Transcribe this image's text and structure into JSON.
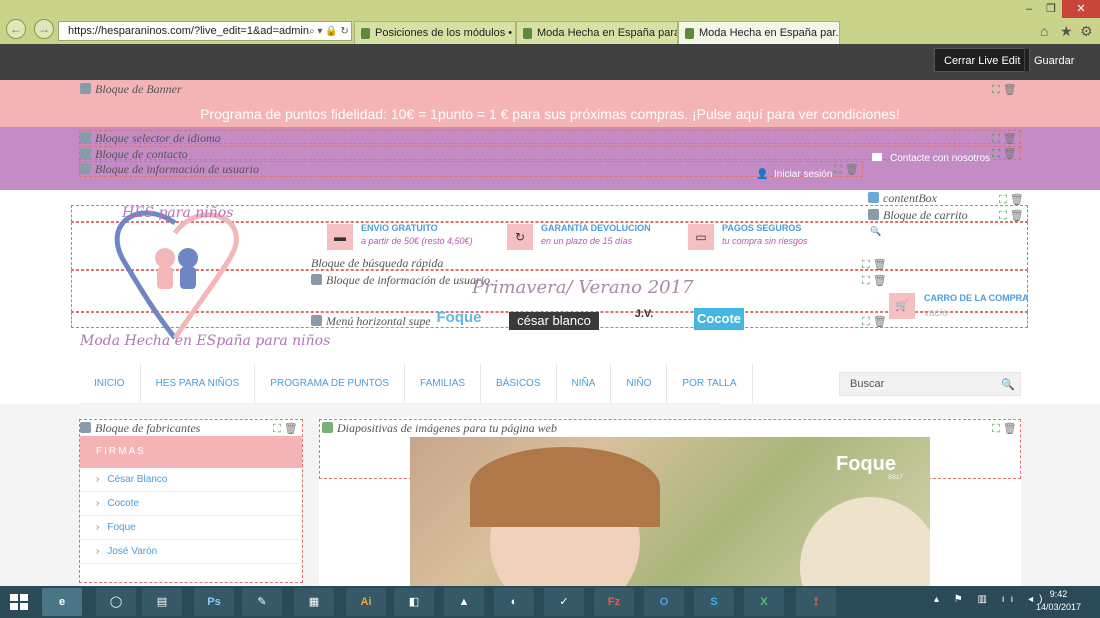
{
  "browser": {
    "url": "https://hesparaninos.com/?live_edit=1&ad=admin",
    "url_tail": "⌕ ▾ 🔒 ↻",
    "tabs": [
      {
        "label": "Posiciones de los módulos • H...",
        "active": false
      },
      {
        "label": "Moda Hecha en España para ni...",
        "active": false
      },
      {
        "label": "Moda Hecha en España par...",
        "active": true
      }
    ],
    "window_controls": [
      "–",
      "❐",
      "✕"
    ],
    "toolbar_icons": [
      "⌂",
      "★",
      "⚙"
    ]
  },
  "live_edit": {
    "close_label": "Cerrar Live Edit",
    "save_label": "Guardar"
  },
  "modules": {
    "banner": "Bloque de Banner",
    "banner_text": "Programa de puntos fidelidad: 10€ = 1punto = 1 € para sus próximas compras. ¡Pulse aquí para ver condiciones!",
    "language": "Bloque selector de idioma",
    "contact": "Bloque de contacto",
    "user_info": "Bloque de información de usuario",
    "contact_link": "Contacte con nosotros",
    "login_link": "Iniciar sesión",
    "contentbox": "contentBox",
    "cart_block": "Bloque de carrito",
    "quick_search": "Bloque de búsqueda rápida",
    "user_info_2": "Bloque de información de usuario",
    "horizontal_menu": "Menú horizontal supe",
    "manufacturers": "Bloque de fabricantes",
    "slideshow": "Diapositivas de imágenes para tu página web"
  },
  "logo": {
    "brand_top": "HES para niños",
    "brand_text": "Moda Hecha en ESpaña para niños"
  },
  "features": [
    {
      "title": "ENVIO GRATUITO",
      "subtitle": "a partir de 50€ (resto 4,50€)",
      "icon": "truck-icon"
    },
    {
      "title": "GARANTÍA DEVOLUCION",
      "subtitle": "en un plazo de 15 días",
      "icon": "return-icon"
    },
    {
      "title": "PAGOS SEGUROS",
      "subtitle": "tu compra sin riesgos",
      "icon": "card-icon"
    }
  ],
  "season": "Primavera/ Verano 2017",
  "brands": [
    "Foque",
    "césar blanco",
    "J.V.",
    "Cocote"
  ],
  "cart": {
    "title": "CARRO DE LA COMPRA",
    "status": "vacío"
  },
  "menu": [
    "INICIO",
    "HES PARA NIÑOS",
    "PROGRAMA DE PUNTOS",
    "FAMILIAS",
    "BÁSICOS",
    "NIÑA",
    "NIÑO",
    "POR TALLA"
  ],
  "search": {
    "placeholder": "Buscar"
  },
  "sidebar": {
    "header": "FIRMAS",
    "items": [
      "César Blanco",
      "Cocote",
      "Foque",
      "José Varón"
    ]
  },
  "slide": {
    "brand": "Foque",
    "sub": "SS17"
  },
  "taskbar": {
    "apps": [
      "e",
      "◯",
      "▤",
      "Ps",
      "✎",
      "▦",
      "Ai",
      "◧",
      "▲",
      "◐",
      "✓",
      "Fz",
      "O",
      "S",
      "X",
      "⟟"
    ],
    "tray": "▴ ⚑ ▥ ıı ◂)",
    "time": "9:42",
    "date": "14/03/2017"
  },
  "colors": {
    "banner": "#f4b4b6",
    "purple": "#c48cc4",
    "accent_blue": "#4a9ed6",
    "accent_purple": "#b55ab0"
  }
}
